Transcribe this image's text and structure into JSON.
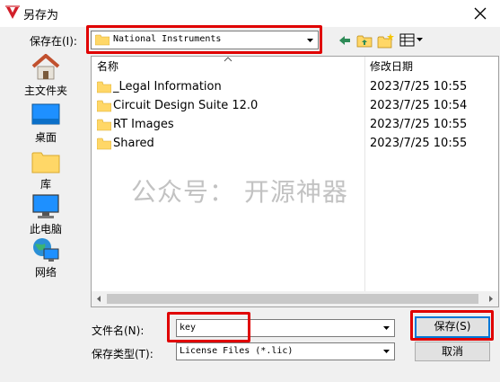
{
  "window": {
    "title": "另存为"
  },
  "save_in": {
    "label": "保存在(I):",
    "location": "National Instruments"
  },
  "places": [
    {
      "label": "主文件夹",
      "icon": "home-icon"
    },
    {
      "label": "桌面",
      "icon": "desktop-icon"
    },
    {
      "label": "库",
      "icon": "library-icon"
    },
    {
      "label": "此电脑",
      "icon": "computer-icon"
    },
    {
      "label": "网络",
      "icon": "network-icon"
    }
  ],
  "file_list": {
    "columns": {
      "name": "名称",
      "date": "修改日期"
    },
    "rows": [
      {
        "name": "_Legal Information",
        "date": "2023/7/25 10:55"
      },
      {
        "name": "Circuit Design Suite 12.0",
        "date": "2023/7/25 10:54"
      },
      {
        "name": "RT Images",
        "date": "2023/7/25 10:55"
      },
      {
        "name": "Shared",
        "date": "2023/7/25 10:55"
      }
    ]
  },
  "watermark": "公众号： 开源神器",
  "file_name": {
    "label": "文件名(N):",
    "value": "key"
  },
  "file_type": {
    "label": "保存类型(T):",
    "value": "License Files (*.lic)"
  },
  "buttons": {
    "save": "保存(S)",
    "cancel": "取消"
  },
  "colors": {
    "highlight": "#e00000",
    "folder": "#ffd767",
    "accent": "#0078d7"
  }
}
